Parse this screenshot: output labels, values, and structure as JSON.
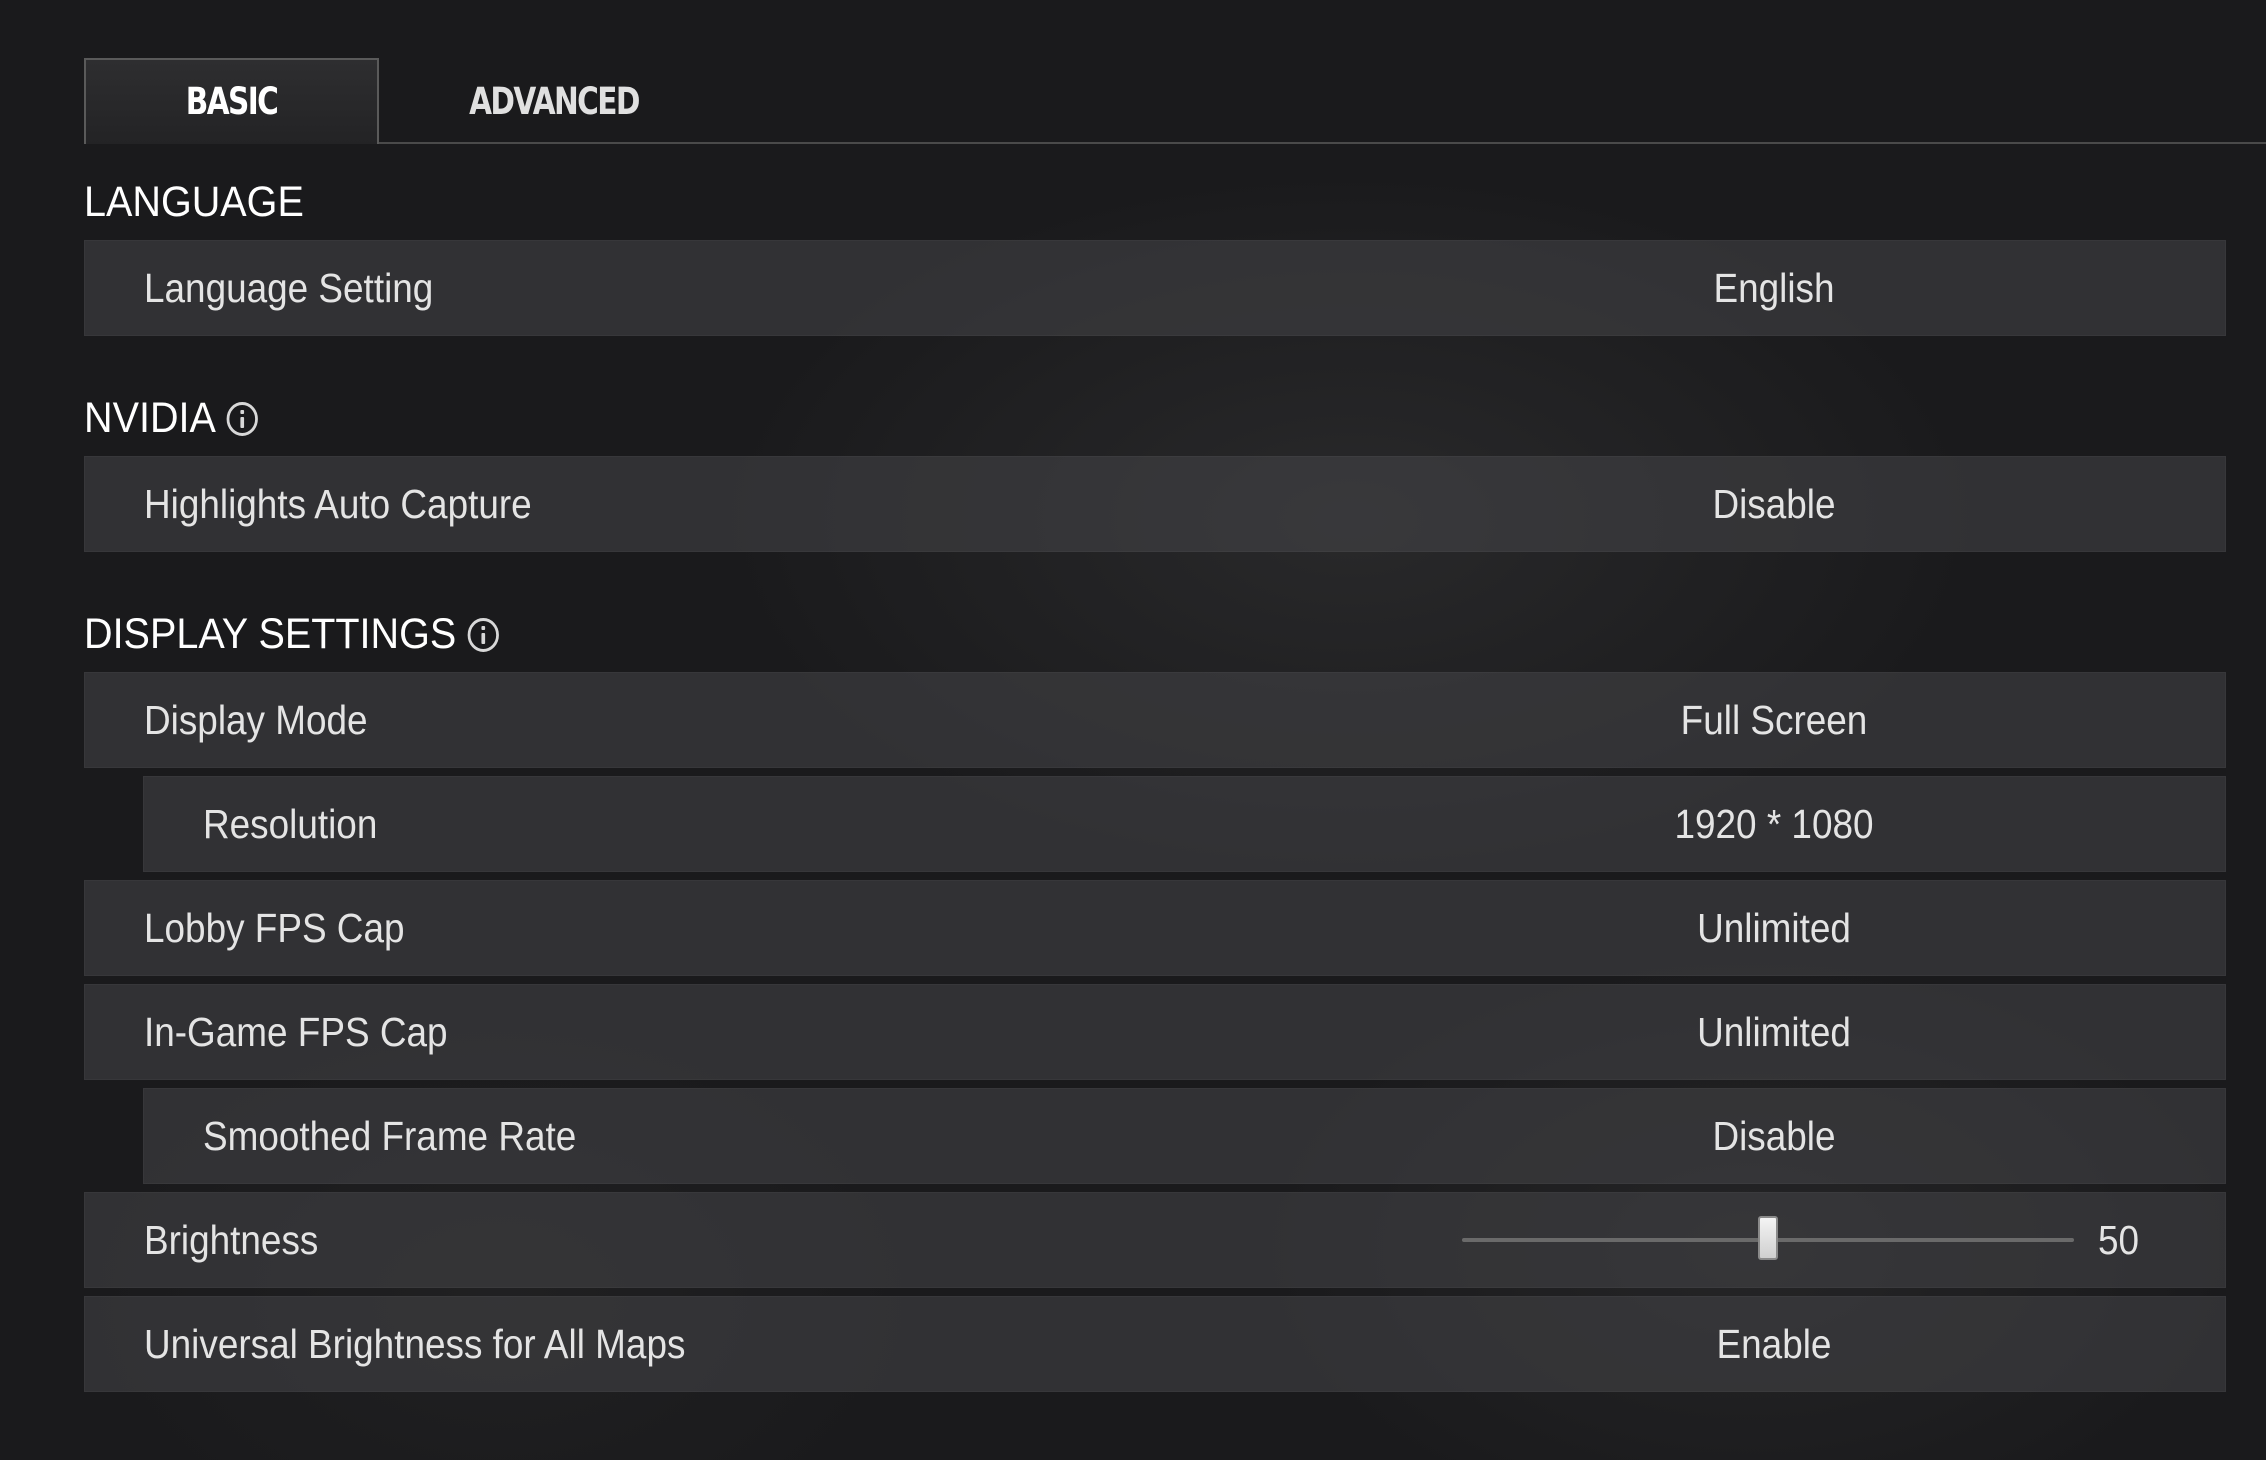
{
  "tabs": [
    {
      "label": "BASIC",
      "active": true
    },
    {
      "label": "ADVANCED",
      "active": false
    }
  ],
  "sections": {
    "language": {
      "title": "LANGUAGE",
      "rows": [
        {
          "label": "Language Setting",
          "value": "English"
        }
      ]
    },
    "nvidia": {
      "title": "NVIDIA",
      "info_icon": "info-icon",
      "rows": [
        {
          "label": "Highlights Auto Capture",
          "value": "Disable"
        }
      ]
    },
    "display": {
      "title": "DISPLAY SETTINGS",
      "info_icon": "info-icon",
      "rows": [
        {
          "label": "Display Mode",
          "value": "Full Screen"
        },
        {
          "label": "Resolution",
          "value": "1920 * 1080",
          "indented": true
        },
        {
          "label": "Lobby FPS Cap",
          "value": "Unlimited"
        },
        {
          "label": "In-Game FPS Cap",
          "value": "Unlimited"
        },
        {
          "label": "Smoothed Frame Rate",
          "value": "Disable",
          "indented": true
        },
        {
          "label": "Brightness",
          "value": "50",
          "slider": {
            "min": 0,
            "max": 100,
            "value": 50
          }
        },
        {
          "label": "Universal Brightness for All Maps",
          "value": "Enable"
        }
      ]
    }
  },
  "colors": {
    "background": "#1a1a1c",
    "row_background": "#3b3b3d",
    "text": "#e4e4e4",
    "title_text": "#ffffff"
  }
}
